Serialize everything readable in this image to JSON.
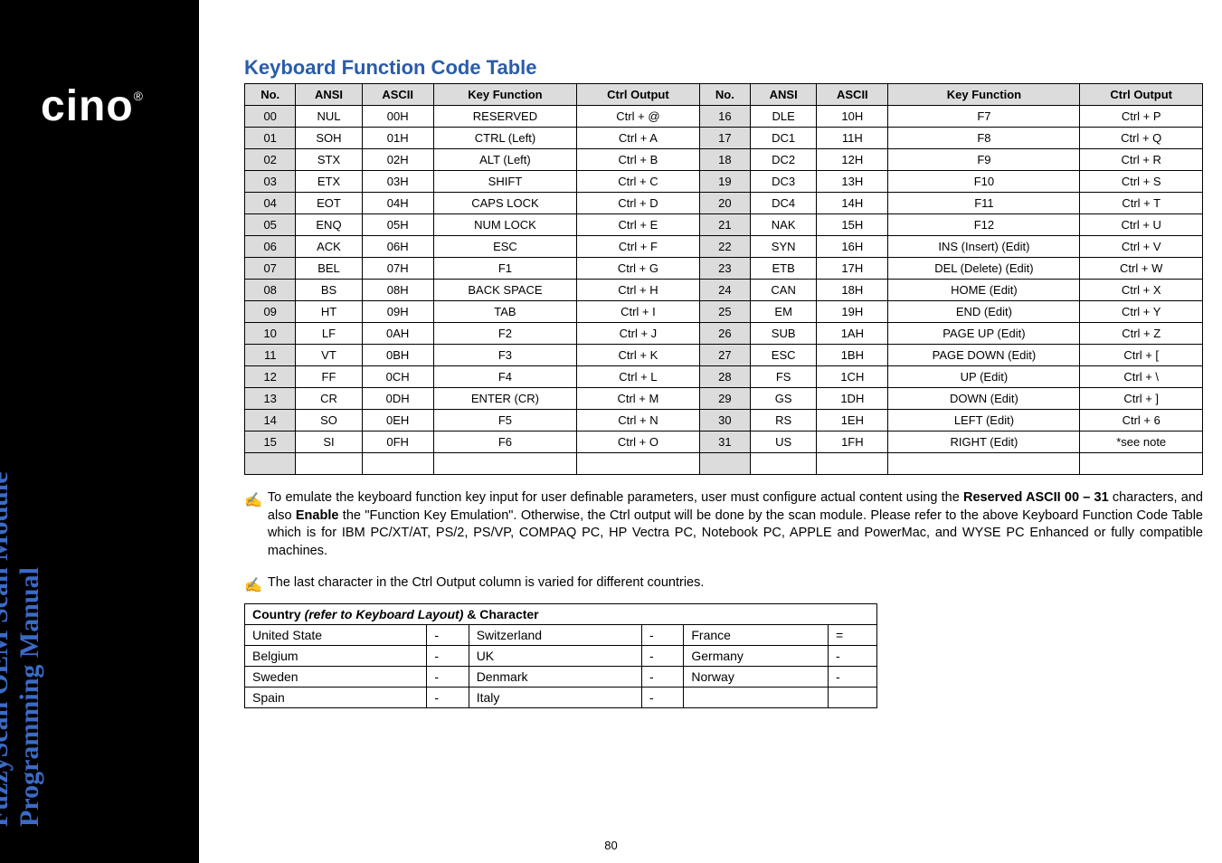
{
  "logo": "cino",
  "logo_reg": "®",
  "vtitle_line1": "FuzzyScan OEM Scan Module",
  "vtitle_line2": "Programming Manual",
  "title": "Keyboard Function Code Table",
  "headers": {
    "no": "No.",
    "ansi": "ANSI",
    "ascii": "ASCII",
    "keyfn": "Key Function",
    "ctrl": "Ctrl Output"
  },
  "rows_left": [
    {
      "no": "00",
      "ansi": "NUL",
      "ascii": "00H",
      "keyfn": "RESERVED",
      "ctrl": "Ctrl + @"
    },
    {
      "no": "01",
      "ansi": "SOH",
      "ascii": "01H",
      "keyfn": "CTRL (Left)",
      "ctrl": "Ctrl + A"
    },
    {
      "no": "02",
      "ansi": "STX",
      "ascii": "02H",
      "keyfn": "ALT (Left)",
      "ctrl": "Ctrl + B"
    },
    {
      "no": "03",
      "ansi": "ETX",
      "ascii": "03H",
      "keyfn": "SHIFT",
      "ctrl": "Ctrl + C"
    },
    {
      "no": "04",
      "ansi": "EOT",
      "ascii": "04H",
      "keyfn": "CAPS LOCK",
      "ctrl": "Ctrl + D"
    },
    {
      "no": "05",
      "ansi": "ENQ",
      "ascii": "05H",
      "keyfn": "NUM LOCK",
      "ctrl": "Ctrl + E"
    },
    {
      "no": "06",
      "ansi": "ACK",
      "ascii": "06H",
      "keyfn": "ESC",
      "ctrl": "Ctrl + F"
    },
    {
      "no": "07",
      "ansi": "BEL",
      "ascii": "07H",
      "keyfn": "F1",
      "ctrl": "Ctrl + G"
    },
    {
      "no": "08",
      "ansi": "BS",
      "ascii": "08H",
      "keyfn": "BACK SPACE",
      "ctrl": "Ctrl + H"
    },
    {
      "no": "09",
      "ansi": "HT",
      "ascii": "09H",
      "keyfn": "TAB",
      "ctrl": "Ctrl + I"
    },
    {
      "no": "10",
      "ansi": "LF",
      "ascii": "0AH",
      "keyfn": "F2",
      "ctrl": "Ctrl + J"
    },
    {
      "no": "11",
      "ansi": "VT",
      "ascii": "0BH",
      "keyfn": "F3",
      "ctrl": "Ctrl + K"
    },
    {
      "no": "12",
      "ansi": "FF",
      "ascii": "0CH",
      "keyfn": "F4",
      "ctrl": "Ctrl + L"
    },
    {
      "no": "13",
      "ansi": "CR",
      "ascii": "0DH",
      "keyfn": "ENTER (CR)",
      "ctrl": "Ctrl + M"
    },
    {
      "no": "14",
      "ansi": "SO",
      "ascii": "0EH",
      "keyfn": "F5",
      "ctrl": "Ctrl + N"
    },
    {
      "no": "15",
      "ansi": "SI",
      "ascii": "0FH",
      "keyfn": "F6",
      "ctrl": "Ctrl + O"
    }
  ],
  "rows_right": [
    {
      "no": "16",
      "ansi": "DLE",
      "ascii": "10H",
      "keyfn": "F7",
      "ctrl": "Ctrl + P"
    },
    {
      "no": "17",
      "ansi": "DC1",
      "ascii": "11H",
      "keyfn": "F8",
      "ctrl": "Ctrl + Q"
    },
    {
      "no": "18",
      "ansi": "DC2",
      "ascii": "12H",
      "keyfn": "F9",
      "ctrl": "Ctrl + R"
    },
    {
      "no": "19",
      "ansi": "DC3",
      "ascii": "13H",
      "keyfn": "F10",
      "ctrl": "Ctrl + S"
    },
    {
      "no": "20",
      "ansi": "DC4",
      "ascii": "14H",
      "keyfn": "F11",
      "ctrl": "Ctrl + T"
    },
    {
      "no": "21",
      "ansi": "NAK",
      "ascii": "15H",
      "keyfn": "F12",
      "ctrl": "Ctrl + U"
    },
    {
      "no": "22",
      "ansi": "SYN",
      "ascii": "16H",
      "keyfn": "INS (Insert) (Edit)",
      "ctrl": "Ctrl + V"
    },
    {
      "no": "23",
      "ansi": "ETB",
      "ascii": "17H",
      "keyfn": "DEL (Delete) (Edit)",
      "ctrl": "Ctrl + W"
    },
    {
      "no": "24",
      "ansi": "CAN",
      "ascii": "18H",
      "keyfn": "HOME (Edit)",
      "ctrl": "Ctrl + X"
    },
    {
      "no": "25",
      "ansi": "EM",
      "ascii": "19H",
      "keyfn": "END (Edit)",
      "ctrl": "Ctrl + Y"
    },
    {
      "no": "26",
      "ansi": "SUB",
      "ascii": "1AH",
      "keyfn": "PAGE UP (Edit)",
      "ctrl": "Ctrl + Z"
    },
    {
      "no": "27",
      "ansi": "ESC",
      "ascii": "1BH",
      "keyfn": "PAGE DOWN (Edit)",
      "ctrl": "Ctrl + ["
    },
    {
      "no": "28",
      "ansi": "FS",
      "ascii": "1CH",
      "keyfn": "UP (Edit)",
      "ctrl": "Ctrl + \\"
    },
    {
      "no": "29",
      "ansi": "GS",
      "ascii": "1DH",
      "keyfn": "DOWN (Edit)",
      "ctrl": "Ctrl + ]"
    },
    {
      "no": "30",
      "ansi": "RS",
      "ascii": "1EH",
      "keyfn": "LEFT (Edit)",
      "ctrl": "Ctrl + 6"
    },
    {
      "no": "31",
      "ansi": "US",
      "ascii": "1FH",
      "keyfn": "RIGHT (Edit)",
      "ctrl": "*see note"
    }
  ],
  "note1_pre": "To emulate the keyboard function key input for user definable parameters, user must configure actual content using the ",
  "note1_b1": "Reserved ASCII 00 – 31",
  "note1_mid": " characters, and also ",
  "note1_b2": "Enable",
  "note1_post": " the \"Function Key Emulation\". Otherwise, the Ctrl output will be done by the scan module. Please refer to the above Keyboard Function Code Table which is for IBM PC/XT/AT, PS/2, PS/VP, COMPAQ PC, HP Vectra PC, Notebook PC, APPLE and PowerMac, and WYSE PC Enhanced or fully compatible machines.",
  "note2": "The last character in the Ctrl Output column is varied for different countries.",
  "ct_header_b1": "Country ",
  "ct_header_i": "(refer to Keyboard Layout)",
  "ct_header_b2": " & Character",
  "country_rows": [
    [
      "United State",
      "-",
      "Switzerland",
      "-",
      "France",
      "="
    ],
    [
      "Belgium",
      "-",
      "UK",
      "-",
      "Germany",
      "-"
    ],
    [
      "Sweden",
      "-",
      "Denmark",
      "-",
      "Norway",
      "-"
    ],
    [
      "Spain",
      "-",
      "Italy",
      "-",
      "",
      ""
    ]
  ],
  "pagenum": "80",
  "point_icon": "✍"
}
